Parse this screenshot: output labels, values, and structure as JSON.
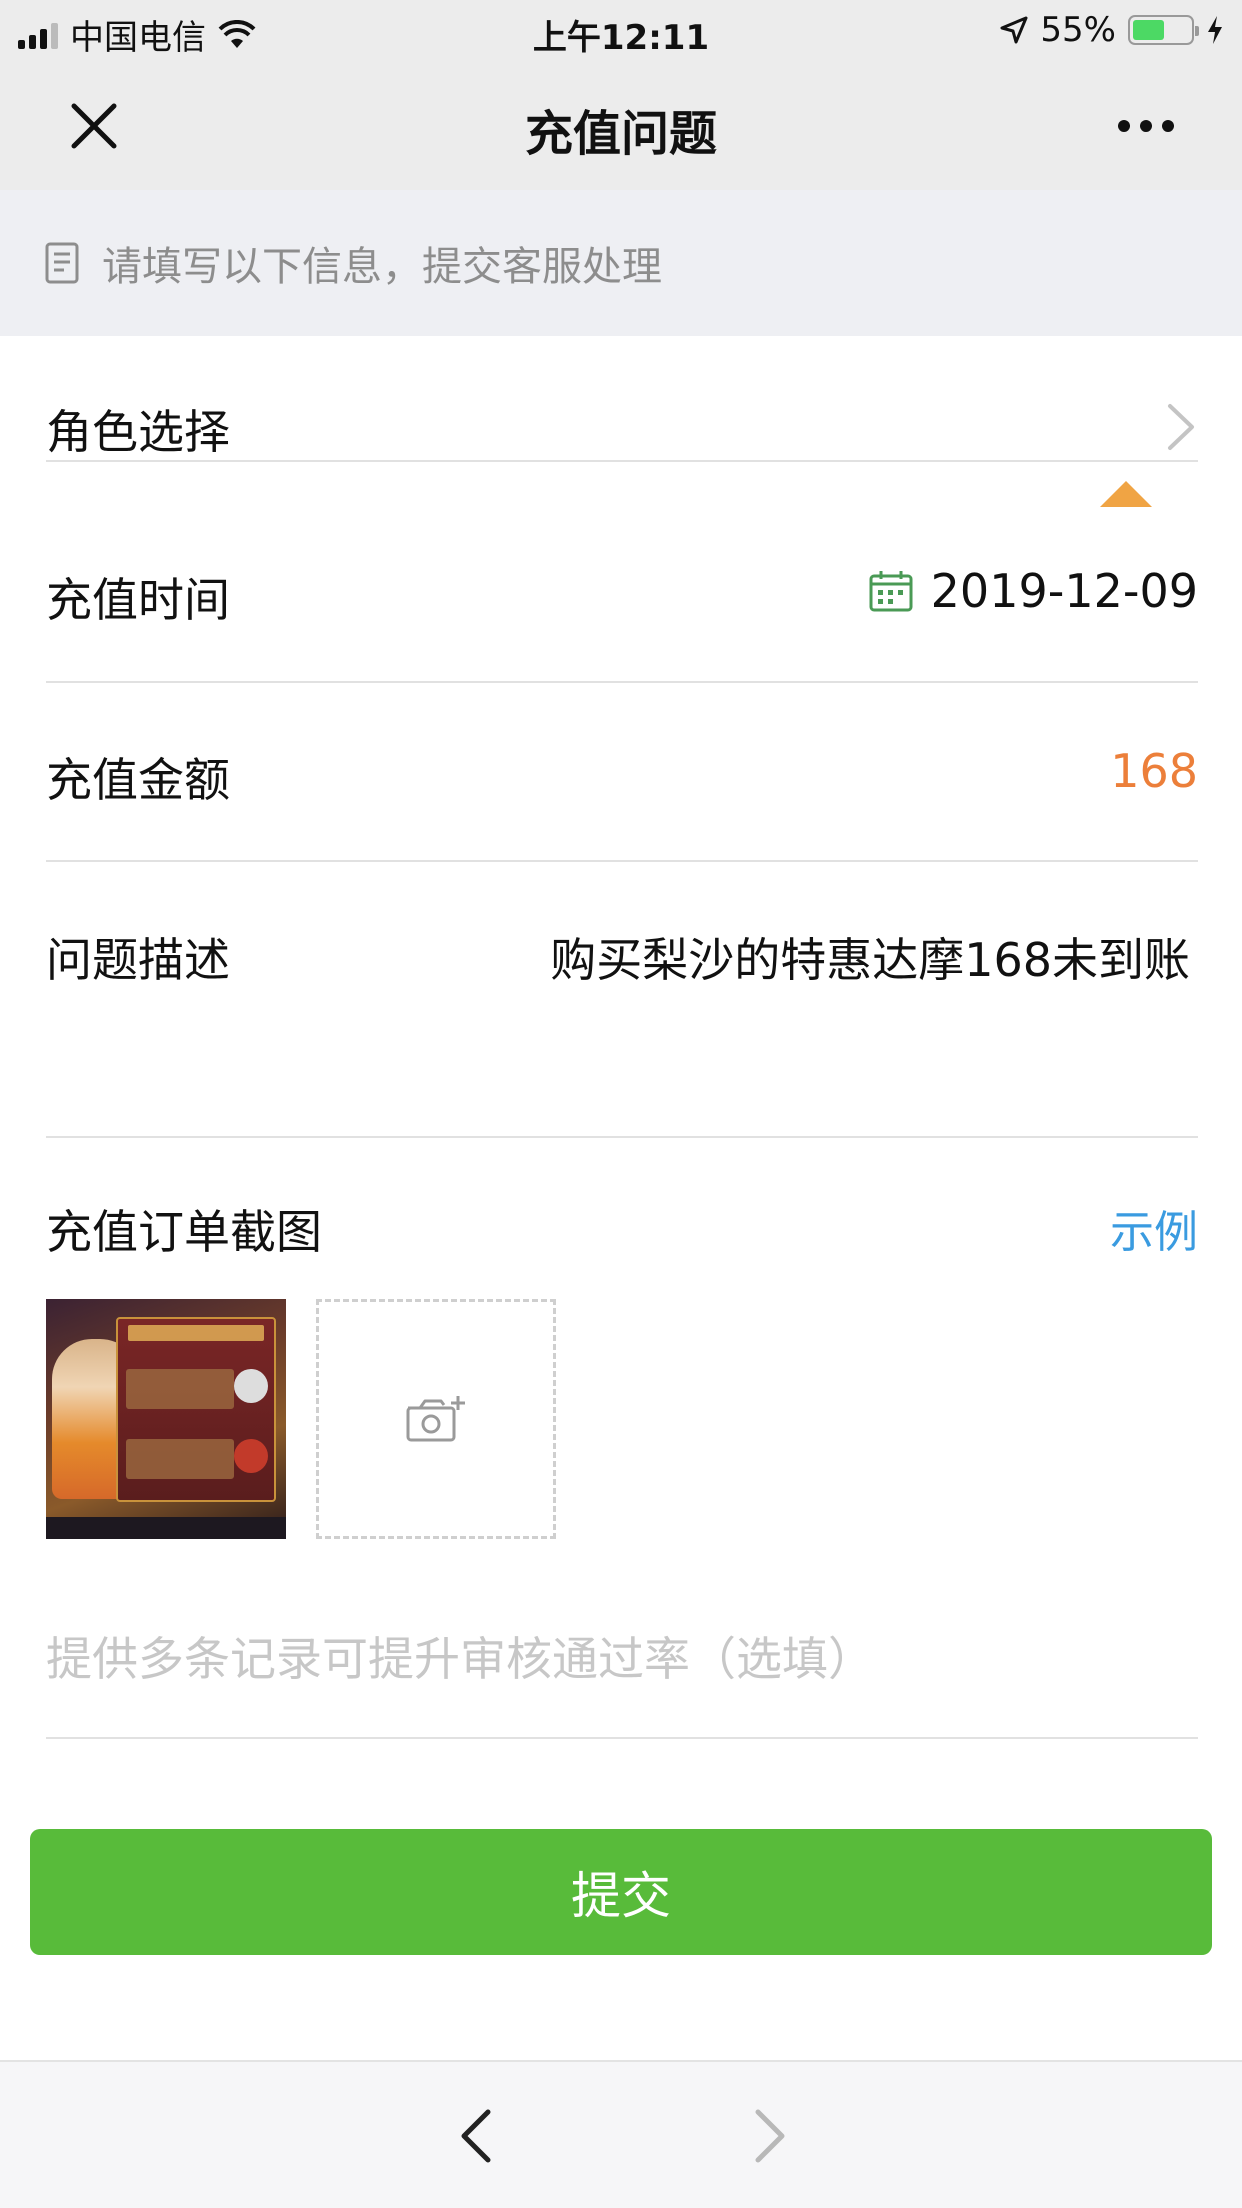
{
  "status_bar": {
    "carrier": "中国电信",
    "time": "上午12:11",
    "battery_percent": "55%",
    "battery_level": 0.55
  },
  "nav": {
    "title": "充值问题"
  },
  "hint": {
    "text": "请填写以下信息，提交客服处理"
  },
  "form": {
    "role": {
      "label": "角色选择"
    },
    "time": {
      "label": "充值时间",
      "value": "2019-12-09"
    },
    "amount": {
      "label": "充值金额",
      "value": "168"
    },
    "description": {
      "label": "问题描述",
      "value": "购买梨沙的特惠达摩168未到账"
    },
    "screenshot": {
      "label": "充值订单截图",
      "example_link": "示例"
    },
    "optional": {
      "placeholder": "提供多条记录可提升审核通过率（选填）",
      "value": ""
    }
  },
  "submit": {
    "label": "提交"
  },
  "colors": {
    "accent_green": "#58bb3a",
    "amount_orange": "#ec7f3a",
    "link_blue": "#3a9be0",
    "tip_orange": "#f0a444"
  },
  "icons": [
    "signal-icon",
    "wifi-icon",
    "location-icon",
    "battery-icon",
    "charging-icon",
    "close-icon",
    "more-icon",
    "document-icon",
    "chevron-right-icon",
    "calendar-icon",
    "camera-add-icon",
    "back-arrow-icon",
    "forward-arrow-icon"
  ]
}
